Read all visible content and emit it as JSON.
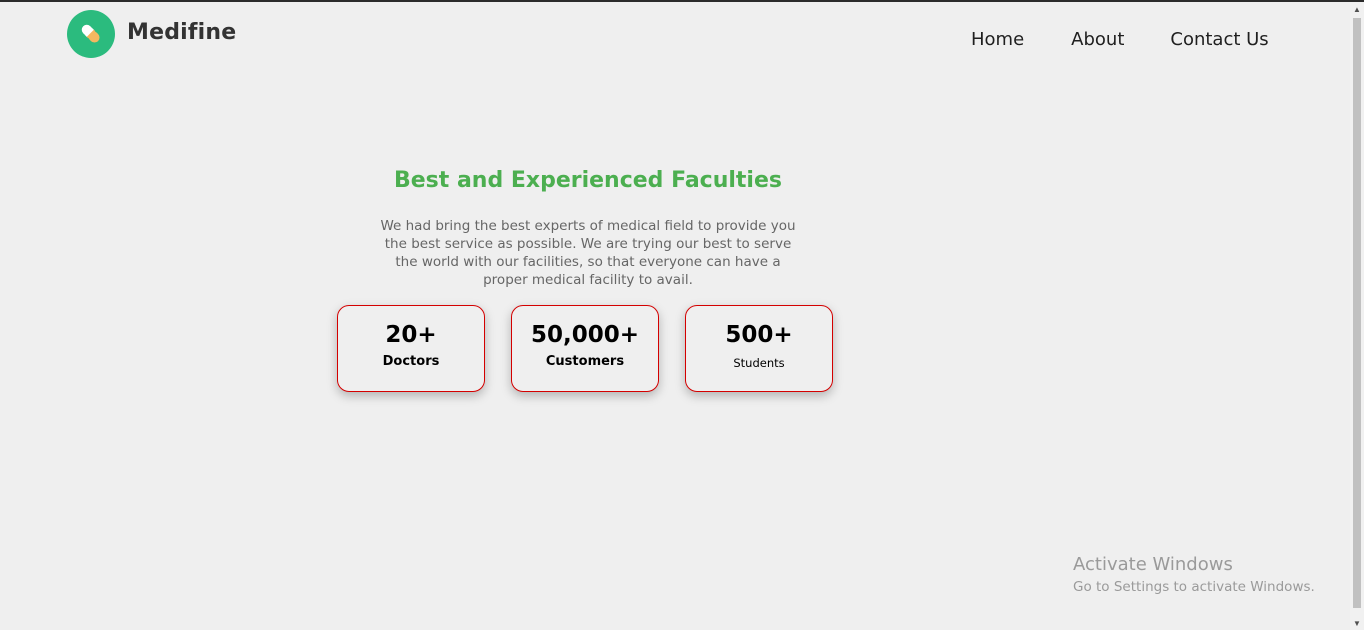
{
  "header": {
    "brand": "Medifine",
    "nav": [
      "Home",
      "About",
      "Contact Us"
    ]
  },
  "main": {
    "heading": "Best and Experienced Faculties",
    "description": "We had bring the best experts of medical field to provide you the best service as possible. We are trying our best to serve the world with our facilities, so that everyone can have a proper medical facility to avail.",
    "stats": [
      {
        "value": "20+",
        "label": "Doctors"
      },
      {
        "value": "50,000+",
        "label": "Customers"
      },
      {
        "value": "500+",
        "label": "Students"
      }
    ]
  },
  "watermark": {
    "title": "Activate Windows",
    "subtitle": "Go to Settings to activate Windows."
  },
  "colors": {
    "accent_green": "#4caf50",
    "logo_green": "#2bbb7e",
    "card_border": "#d40000"
  },
  "icons": {
    "logo": "pill-icon",
    "scroll_up": "scroll-up-arrow-icon",
    "scroll_down": "scroll-down-arrow-icon"
  }
}
